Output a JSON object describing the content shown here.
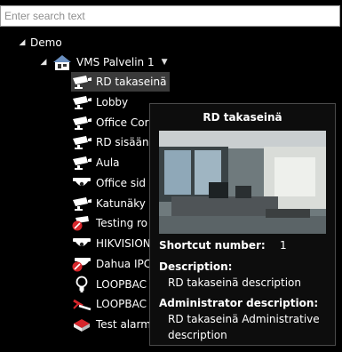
{
  "search": {
    "placeholder": "Enter search text"
  },
  "tree": {
    "root": {
      "label": "Demo"
    },
    "server": {
      "label": "VMS Palvelin 1"
    },
    "items": [
      {
        "label": "RD takaseinä",
        "icon": "ptz-camera-icon"
      },
      {
        "label": "Lobby",
        "icon": "camera-icon"
      },
      {
        "label": "Office Cor",
        "icon": "camera-icon"
      },
      {
        "label": "RD sisään",
        "icon": "camera-icon"
      },
      {
        "label": "Aula",
        "icon": "camera-icon"
      },
      {
        "label": "Office sid",
        "icon": "dome-camera-icon"
      },
      {
        "label": "Katunäky",
        "icon": "camera-icon"
      },
      {
        "label": "Testing ro",
        "icon": "camera-error-icon"
      },
      {
        "label": "HIKVISION",
        "icon": "dome-camera-icon"
      },
      {
        "label": "Dahua IPC",
        "icon": "dome-camera-error-icon"
      },
      {
        "label": "LOOPBAC",
        "icon": "lightbulb-icon"
      },
      {
        "label": "LOOPBAC",
        "icon": "disconnected-icon"
      },
      {
        "label": "Test alarm",
        "icon": "alarm-icon"
      }
    ]
  },
  "tooltip": {
    "title": "RD takaseinä",
    "shortcut_label": "Shortcut number:",
    "shortcut_value": "1",
    "description_label": "Description:",
    "description": "RD takaseinä description",
    "admin_label": "Administrator description:",
    "admin_line1": "RD takaseinä Administrative",
    "admin_line2": "description"
  },
  "colors": {
    "background": "#000000",
    "selected": "#3a3a3a",
    "error": "#d6262b"
  }
}
